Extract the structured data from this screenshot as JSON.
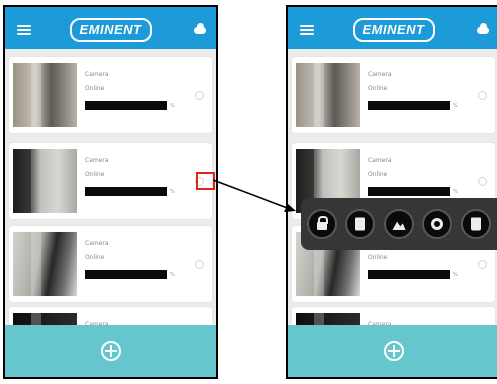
{
  "app": {
    "logo_text": "EMINENT"
  },
  "cameras": [
    {
      "name": "Camera",
      "status": "Online",
      "signal_label": "%",
      "thumb": "hallway"
    },
    {
      "name": "Camera",
      "status": "Online",
      "signal_label": "%",
      "thumb": "office"
    },
    {
      "name": "Camera",
      "status": "Online",
      "signal_label": "%",
      "thumb": "room"
    },
    {
      "name": "Camera",
      "thumb": "dark"
    }
  ],
  "action_menu": {
    "items": [
      {
        "icon": "lock-icon"
      },
      {
        "icon": "document-icon"
      },
      {
        "icon": "image-icon"
      },
      {
        "icon": "gear-icon"
      },
      {
        "icon": "trash-icon"
      }
    ]
  },
  "colors": {
    "header": "#1d9ad8",
    "footer": "#66c6cd",
    "list_background": "#ececec",
    "action_bar": "#363636",
    "highlight": "#e2231a",
    "arrow": "#000000"
  },
  "icons": {
    "menu": "hamburger-icon",
    "cloud": "cloud-icon",
    "add": "add-icon",
    "status_dot": "status-dot-icon"
  }
}
